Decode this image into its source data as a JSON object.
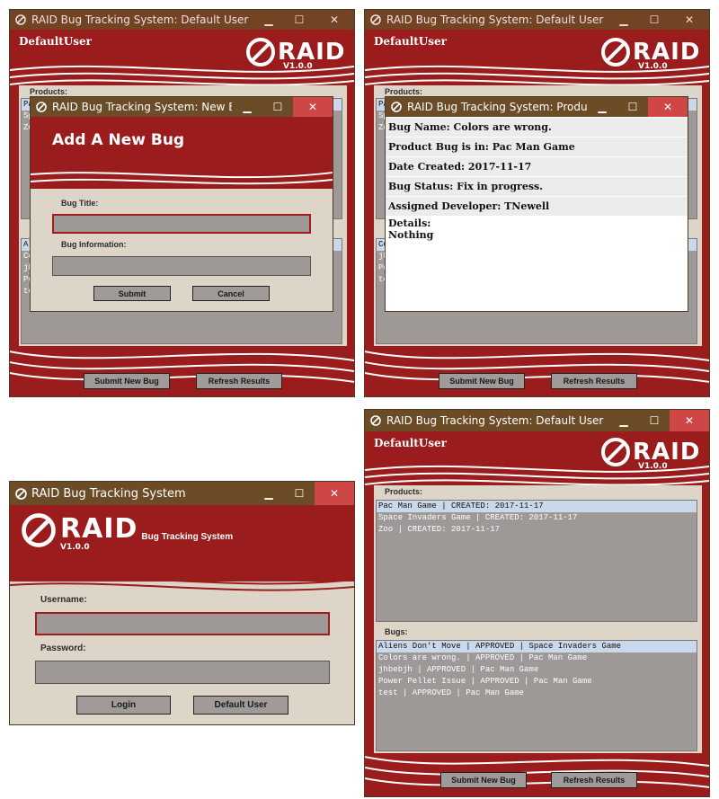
{
  "colors": {
    "brand_red": "#9b1c1c",
    "titlebar": "#6b4c26",
    "panel": "#ddd6c8",
    "list": "#9e9896",
    "close": "#cf4646"
  },
  "logo": {
    "text": "RAID",
    "version": "V1.0.0",
    "tagline": "Bug Tracking System"
  },
  "win_new_bug": {
    "title": "RAID Bug Tracking System: Default User",
    "user": "DefaultUser",
    "products_label": "Products:",
    "list_stub_chars": [
      "Pa",
      "Sp",
      "Zo"
    ],
    "bugs_stub_chars": [
      "Al",
      "Co",
      "jh",
      "Po",
      "te"
    ],
    "submit_new_bug": "Submit New Bug",
    "refresh_results": "Refresh Results",
    "dialog": {
      "title": "RAID Bug Tracking System: New B...",
      "heading": "Add A New Bug",
      "bug_title_label": "Bug Title:",
      "bug_info_label": "Bug Information:",
      "submit": "Submit",
      "cancel": "Cancel"
    }
  },
  "win_details": {
    "title": "RAID Bug Tracking System: Default User",
    "user": "DefaultUser",
    "products_label": "Products:",
    "list_stub_chars": [
      "Pa",
      "Sp",
      "Zo"
    ],
    "bugs_stub_chars": [
      "Co",
      "jh",
      "Po",
      "te"
    ],
    "submit_new_bug": "Submit New Bug",
    "refresh_results": "Refresh Results",
    "dialog": {
      "title": "RAID Bug Tracking System: Produ...",
      "bug_name": "Bug Name: Colors are wrong.",
      "product": "Product Bug is in: Pac Man Game",
      "date": "Date Created: 2017-11-17",
      "status": "Bug Status: Fix in progress.",
      "developer": "Assigned Developer: TNewell",
      "details_label": "Details:",
      "details_value": "Nothing"
    }
  },
  "win_login": {
    "title": "RAID Bug Tracking System",
    "username_label": "Username:",
    "password_label": "Password:",
    "login": "Login",
    "default_user": "Default User"
  },
  "win_main": {
    "title": "RAID Bug Tracking System: Default User",
    "user": "DefaultUser",
    "products_label": "Products:",
    "products": [
      "Pac Man Game  |  CREATED: 2017-11-17",
      "Space Invaders Game  |  CREATED: 2017-11-17",
      "Zoo  |  CREATED: 2017-11-17"
    ],
    "bugs_label": "Bugs:",
    "bugs": [
      "Aliens Don't Move  |  APPROVED  |  Space Invaders Game",
      "Colors are wrong.  |  APPROVED  |  Pac Man Game",
      "jhbebjh  |  APPROVED  |  Pac Man Game",
      "Power Pellet Issue  |  APPROVED  |  Pac Man Game",
      "test  |  APPROVED  |  Pac Man Game"
    ],
    "submit_new_bug": "Submit New Bug",
    "refresh_results": "Refresh Results"
  },
  "icons": {
    "app": "raid-logo-icon",
    "minimize": "minimize-icon",
    "maximize": "maximize-icon",
    "close": "close-icon"
  }
}
